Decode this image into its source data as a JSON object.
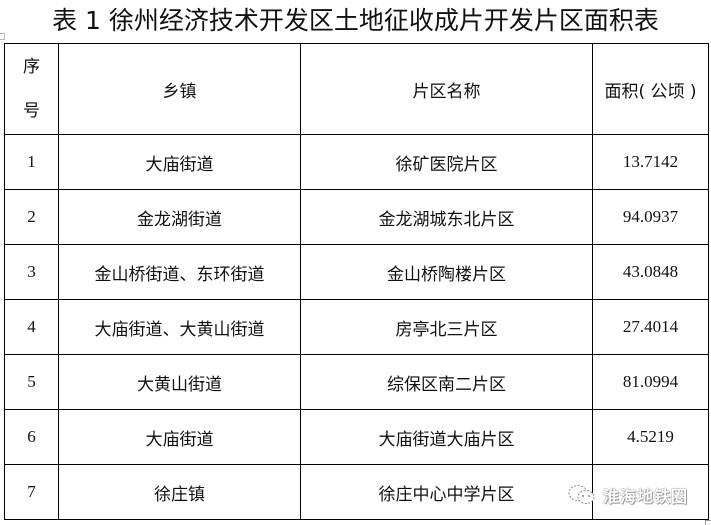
{
  "document": {
    "title": "表 1 徐州经济技术开发区土地征收成片开发片区面积表"
  },
  "table": {
    "headers": {
      "seq_line1": "序",
      "seq_line2": "号",
      "town": "乡镇",
      "zone_name": "片区名称",
      "area": "面积( 公顷 )"
    },
    "rows": [
      {
        "no": "1",
        "town": "大庙街道",
        "zone": "徐矿医院片区",
        "area": "13.7142"
      },
      {
        "no": "2",
        "town": "金龙湖街道",
        "zone": "金龙湖城东北片区",
        "area": "94.0937"
      },
      {
        "no": "3",
        "town": "金山桥街道、东环街道",
        "zone": "金山桥陶楼片区",
        "area": "43.0848"
      },
      {
        "no": "4",
        "town": "大庙街道、大黄山街道",
        "zone": "房亭北三片区",
        "area": "27.4014"
      },
      {
        "no": "5",
        "town": "大黄山街道",
        "zone": "综保区南二片区",
        "area": "81.0994"
      },
      {
        "no": "6",
        "town": "大庙街道",
        "zone": "大庙街道大庙片区",
        "area": "4.5219"
      },
      {
        "no": "7",
        "town": "徐庄镇",
        "zone": "徐庄中心中学片区",
        "area": ""
      }
    ]
  },
  "watermark": {
    "icon": "wechat-icon",
    "text": "淮海地铁圈"
  }
}
